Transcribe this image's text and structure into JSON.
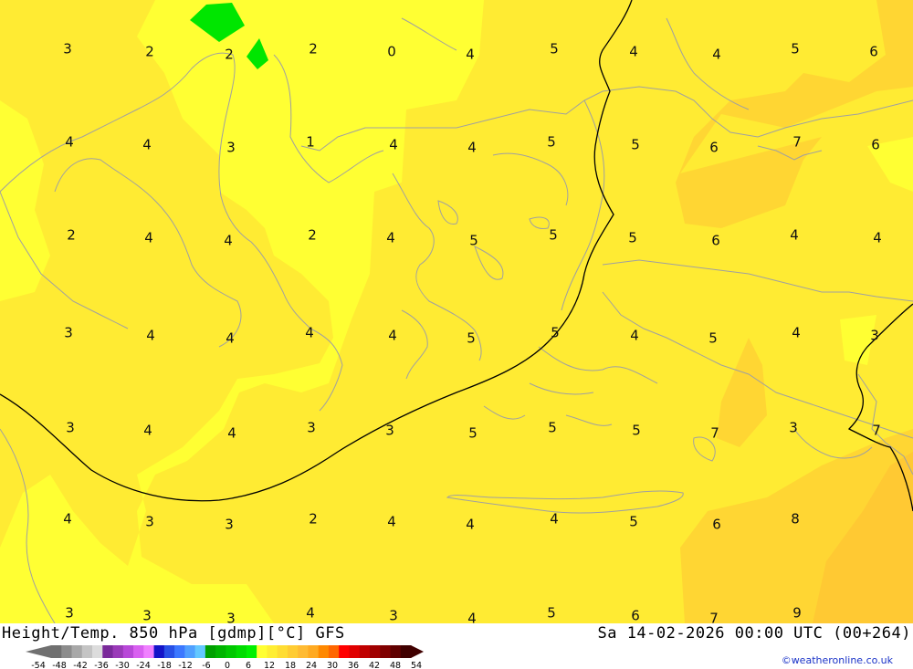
{
  "header": {
    "left_title": "Height/Temp. 850 hPa [gdmp][°C] GFS",
    "right_title": "Sa 14-02-2026 00:00 UTC (00+264)"
  },
  "credit": "©weatheronline.co.uk",
  "colors": {
    "pale_yellow": "#ffff33",
    "yellow": "#ffeb33",
    "deep_yellow": "#ffd633",
    "dark_yellow": "#ffc933",
    "green": "#00e600",
    "coastline": "#a0a0a0",
    "isohypse": "#000000"
  },
  "grid_labels": [
    {
      "text": "3",
      "row": 0,
      "col": 0
    },
    {
      "text": "2",
      "row": 0,
      "col": 1
    },
    {
      "text": "2",
      "row": 0,
      "col": 2
    },
    {
      "text": "2",
      "row": 0,
      "col": 3
    },
    {
      "text": "0",
      "row": 0,
      "col": 4
    },
    {
      "text": "4",
      "row": 0,
      "col": 5
    },
    {
      "text": "5",
      "row": 0,
      "col": 6
    },
    {
      "text": "4",
      "row": 0,
      "col": 7
    },
    {
      "text": "4",
      "row": 0,
      "col": 8
    },
    {
      "text": "5",
      "row": 0,
      "col": 9
    },
    {
      "text": "6",
      "row": 0,
      "col": 10
    },
    {
      "text": "4",
      "row": 1,
      "col": 0
    },
    {
      "text": "4",
      "row": 1,
      "col": 1
    },
    {
      "text": "3",
      "row": 1,
      "col": 2
    },
    {
      "text": "1",
      "row": 1,
      "col": 3
    },
    {
      "text": "4",
      "row": 1,
      "col": 4
    },
    {
      "text": "4",
      "row": 1,
      "col": 5
    },
    {
      "text": "5",
      "row": 1,
      "col": 6
    },
    {
      "text": "5",
      "row": 1,
      "col": 7
    },
    {
      "text": "6",
      "row": 1,
      "col": 8
    },
    {
      "text": "7",
      "row": 1,
      "col": 9
    },
    {
      "text": "6",
      "row": 1,
      "col": 10
    },
    {
      "text": "2",
      "row": 2,
      "col": 0
    },
    {
      "text": "4",
      "row": 2,
      "col": 1
    },
    {
      "text": "4",
      "row": 2,
      "col": 2
    },
    {
      "text": "2",
      "row": 2,
      "col": 3
    },
    {
      "text": "4",
      "row": 2,
      "col": 4
    },
    {
      "text": "5",
      "row": 2,
      "col": 5
    },
    {
      "text": "5",
      "row": 2,
      "col": 6
    },
    {
      "text": "5",
      "row": 2,
      "col": 7
    },
    {
      "text": "6",
      "row": 2,
      "col": 8
    },
    {
      "text": "4",
      "row": 2,
      "col": 9
    },
    {
      "text": "4",
      "row": 2,
      "col": 10
    },
    {
      "text": "3",
      "row": 3,
      "col": 0
    },
    {
      "text": "4",
      "row": 3,
      "col": 1
    },
    {
      "text": "4",
      "row": 3,
      "col": 2
    },
    {
      "text": "4",
      "row": 3,
      "col": 3
    },
    {
      "text": "4",
      "row": 3,
      "col": 4
    },
    {
      "text": "5",
      "row": 3,
      "col": 5
    },
    {
      "text": "5",
      "row": 3,
      "col": 6
    },
    {
      "text": "4",
      "row": 3,
      "col": 7
    },
    {
      "text": "5",
      "row": 3,
      "col": 8
    },
    {
      "text": "4",
      "row": 3,
      "col": 9
    },
    {
      "text": "3",
      "row": 3,
      "col": 10
    },
    {
      "text": "3",
      "row": 4,
      "col": 0
    },
    {
      "text": "4",
      "row": 4,
      "col": 1
    },
    {
      "text": "4",
      "row": 4,
      "col": 2
    },
    {
      "text": "3",
      "row": 4,
      "col": 3
    },
    {
      "text": "3",
      "row": 4,
      "col": 4
    },
    {
      "text": "5",
      "row": 4,
      "col": 5
    },
    {
      "text": "5",
      "row": 4,
      "col": 6
    },
    {
      "text": "5",
      "row": 4,
      "col": 7
    },
    {
      "text": "7",
      "row": 4,
      "col": 8
    },
    {
      "text": "3",
      "row": 4,
      "col": 9
    },
    {
      "text": "7",
      "row": 4,
      "col": 10
    },
    {
      "text": "4",
      "row": 5,
      "col": 0
    },
    {
      "text": "3",
      "row": 5,
      "col": 1
    },
    {
      "text": "3",
      "row": 5,
      "col": 2
    },
    {
      "text": "2",
      "row": 5,
      "col": 3
    },
    {
      "text": "4",
      "row": 5,
      "col": 4
    },
    {
      "text": "4",
      "row": 5,
      "col": 5
    },
    {
      "text": "4",
      "row": 5,
      "col": 6
    },
    {
      "text": "5",
      "row": 5,
      "col": 7
    },
    {
      "text": "6",
      "row": 5,
      "col": 8
    },
    {
      "text": "8",
      "row": 5,
      "col": 9
    },
    {
      "text": "3",
      "row": 6,
      "col": 0
    },
    {
      "text": "3",
      "row": 6,
      "col": 1
    },
    {
      "text": "3",
      "row": 6,
      "col": 2
    },
    {
      "text": "4",
      "row": 6,
      "col": 3
    },
    {
      "text": "3",
      "row": 6,
      "col": 4
    },
    {
      "text": "4",
      "row": 6,
      "col": 5
    },
    {
      "text": "5",
      "row": 6,
      "col": 6
    },
    {
      "text": "6",
      "row": 6,
      "col": 7
    },
    {
      "text": "7",
      "row": 6,
      "col": 8
    },
    {
      "text": "9",
      "row": 6,
      "col": 9
    }
  ],
  "legend": {
    "ticks": [
      "-54",
      "-48",
      "-42",
      "-36",
      "-30",
      "-24",
      "-18",
      "-12",
      "-6",
      "0",
      "6",
      "12",
      "18",
      "24",
      "30",
      "36",
      "42",
      "48",
      "54"
    ],
    "swatches": [
      "#707070",
      "#8c8c8c",
      "#a8a8a8",
      "#c4c4c4",
      "#dcdcdc",
      "#7a2a9a",
      "#9a3ab8",
      "#b848d8",
      "#d860f0",
      "#f080ff",
      "#1414c8",
      "#2850e6",
      "#3c78ff",
      "#50a0ff",
      "#64c8ff",
      "#00a000",
      "#00b400",
      "#00c800",
      "#00dc00",
      "#00f000",
      "#ffff33",
      "#ffee33",
      "#ffdd33",
      "#ffcc33",
      "#ffbb33",
      "#ffaa22",
      "#ff8800",
      "#ff6600",
      "#ff0000",
      "#e00000",
      "#c00000",
      "#a00000",
      "#800000",
      "#600000",
      "#400000"
    ]
  }
}
